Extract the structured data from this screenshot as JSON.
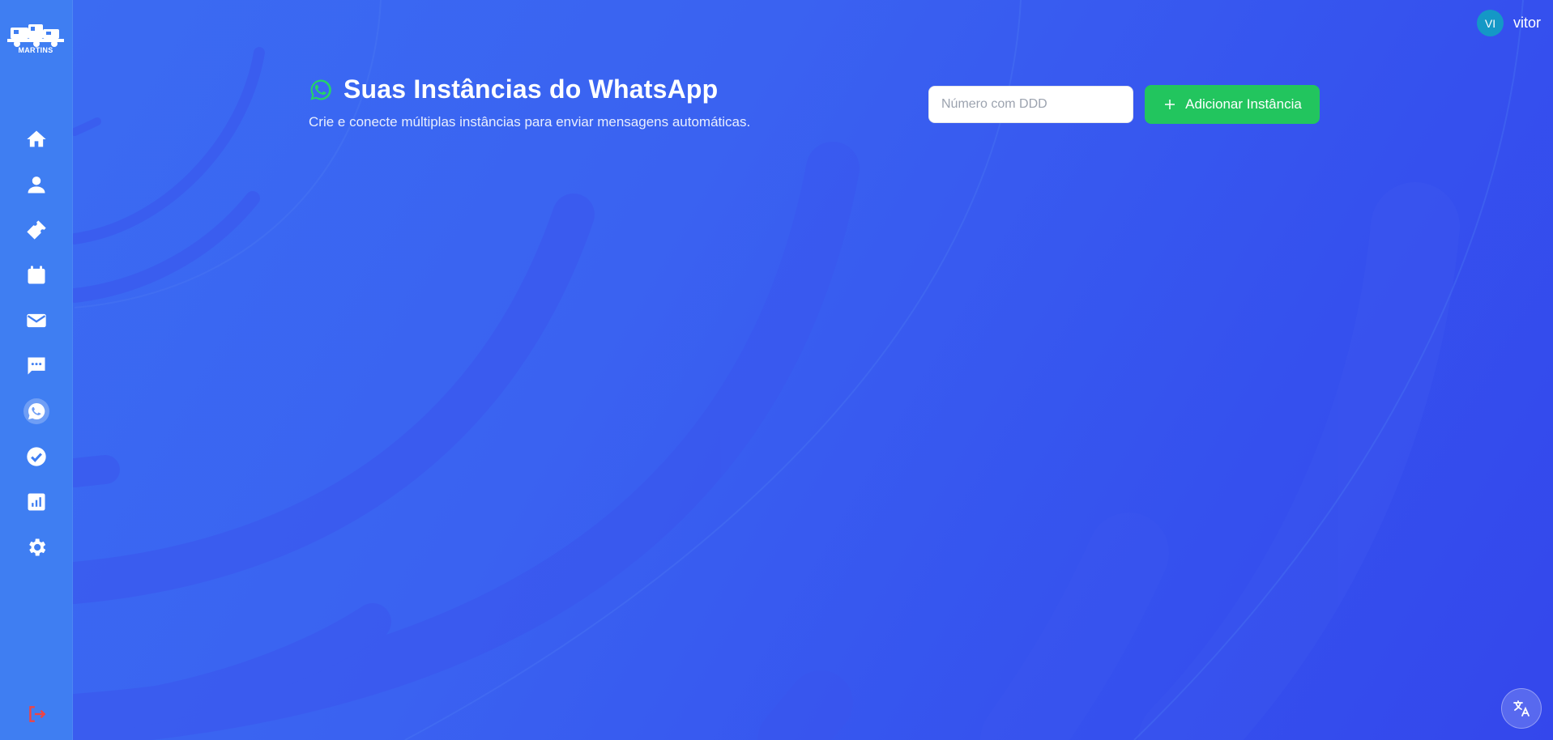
{
  "brand": {
    "logo_text": "MARTINS"
  },
  "user": {
    "initials": "VI",
    "name": "vitor"
  },
  "header": {
    "title": "Suas Instâncias do WhatsApp",
    "subtitle": "Crie e conecte múltiplas instâncias para enviar mensagens automáticas."
  },
  "form": {
    "phone_placeholder": "Número com DDD",
    "phone_value": "",
    "add_label": "Adicionar Instância"
  },
  "sidebar": {
    "items": [
      {
        "icon": "home-icon",
        "active": false
      },
      {
        "icon": "user-icon",
        "active": false
      },
      {
        "icon": "ticket-icon",
        "active": false
      },
      {
        "icon": "calendar-icon",
        "active": false
      },
      {
        "icon": "mail-icon",
        "active": false
      },
      {
        "icon": "chat-icon",
        "active": false
      },
      {
        "icon": "whatsapp-icon",
        "active": true
      },
      {
        "icon": "check-circle-icon",
        "active": false
      },
      {
        "icon": "report-icon",
        "active": false
      },
      {
        "icon": "gear-icon",
        "active": false
      }
    ],
    "logout_icon": "logout-icon"
  },
  "colors": {
    "sidebar": "#3f7ef2",
    "background": "#3a5ef0",
    "accent_green": "#22c55e",
    "avatar": "#1498c6",
    "logout": "#ef4444",
    "whatsapp": "#25d366"
  },
  "translate_icon": "translate-icon"
}
